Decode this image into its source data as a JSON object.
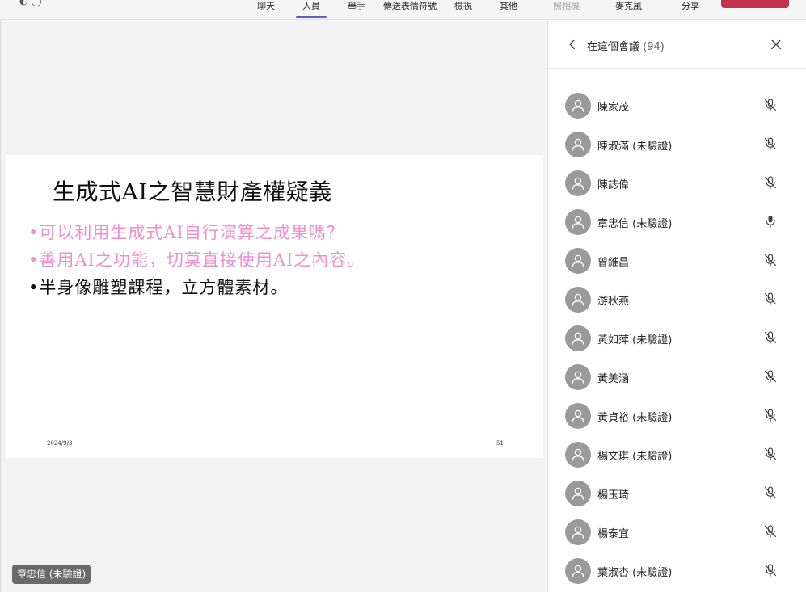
{
  "toolbar": {
    "items": [
      {
        "label": "聊天"
      },
      {
        "label": "人員"
      },
      {
        "label": "舉手"
      },
      {
        "label": "傳送表情符號"
      },
      {
        "label": "檢視"
      },
      {
        "label": "其他"
      },
      {
        "label": "照相機"
      },
      {
        "label": "麥克風"
      },
      {
        "label": "分享"
      }
    ],
    "active": "人員",
    "leave_color": "#c4314b"
  },
  "slide": {
    "title": "生成式AI之智慧財產權疑義",
    "bullets": [
      {
        "text": "•可以利用生成式AI自行演算之成果嗎？",
        "color": "#ee8fd0"
      },
      {
        "text": "•善用AI之功能，切莫直接使用AI之內容。",
        "color": "#ee8fd0"
      },
      {
        "text": "•半身像雕塑課程，立方體素材。",
        "color": "#111111"
      }
    ],
    "date": "2024/9/3",
    "page_number": "51"
  },
  "speaker_tag": "章忠信 (未驗證)",
  "panel": {
    "title": "在這個會議",
    "count": "(94)",
    "participants": [
      {
        "name": "陳家茂",
        "mic": "muted"
      },
      {
        "name": "陳淑滿 (未驗證)",
        "mic": "muted"
      },
      {
        "name": "陳誌偉",
        "mic": "muted"
      },
      {
        "name": "章忠信 (未驗證)",
        "mic": "on"
      },
      {
        "name": "曾維昌",
        "mic": "muted"
      },
      {
        "name": "游秋燕",
        "mic": "muted"
      },
      {
        "name": "黃如萍 (未驗證)",
        "mic": "muted"
      },
      {
        "name": "黃美涵",
        "mic": "muted"
      },
      {
        "name": "黃貞裕 (未驗證)",
        "mic": "muted"
      },
      {
        "name": "楊文琪 (未驗證)",
        "mic": "muted"
      },
      {
        "name": "楊玉琦",
        "mic": "muted"
      },
      {
        "name": "楊泰宜",
        "mic": "muted"
      },
      {
        "name": "葉淑杏 (未驗證)",
        "mic": "muted"
      }
    ]
  },
  "colors": {
    "accent": "#5b5fc7",
    "avatar_bg": "#9a9a9a",
    "bullet_pink": "#ee8fd0"
  }
}
